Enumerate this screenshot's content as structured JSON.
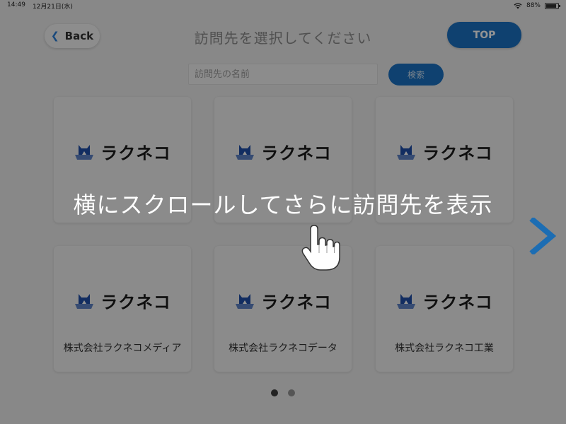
{
  "status_bar": {
    "time": "14:49",
    "date": "12月21日(水)",
    "battery": "88%"
  },
  "header": {
    "back_label": "Back",
    "title": "訪問先を選択してください",
    "top_label": "TOP"
  },
  "search": {
    "placeholder": "訪問先の名前",
    "button_label": "検索"
  },
  "cards": [
    {
      "logo_text": "ラクネコ",
      "name": ""
    },
    {
      "logo_text": "ラクネコ",
      "name": ""
    },
    {
      "logo_text": "ラクネコ",
      "name": ""
    },
    {
      "logo_text": "ラクネコ",
      "name": "株式会社ラクネコメディア"
    },
    {
      "logo_text": "ラクネコ",
      "name": "株式会社ラクネコデータ"
    },
    {
      "logo_text": "ラクネコ",
      "name": "株式会社ラクネコ工業"
    }
  ],
  "overlay": {
    "message": "横にスクロールしてさらに訪問先を表示"
  },
  "pagination": {
    "current_page": 1,
    "total_pages": 2
  },
  "colors": {
    "accent": "#1a71c2",
    "arrow": "#1c6db3",
    "logo_blue": "#1f4fa8"
  }
}
